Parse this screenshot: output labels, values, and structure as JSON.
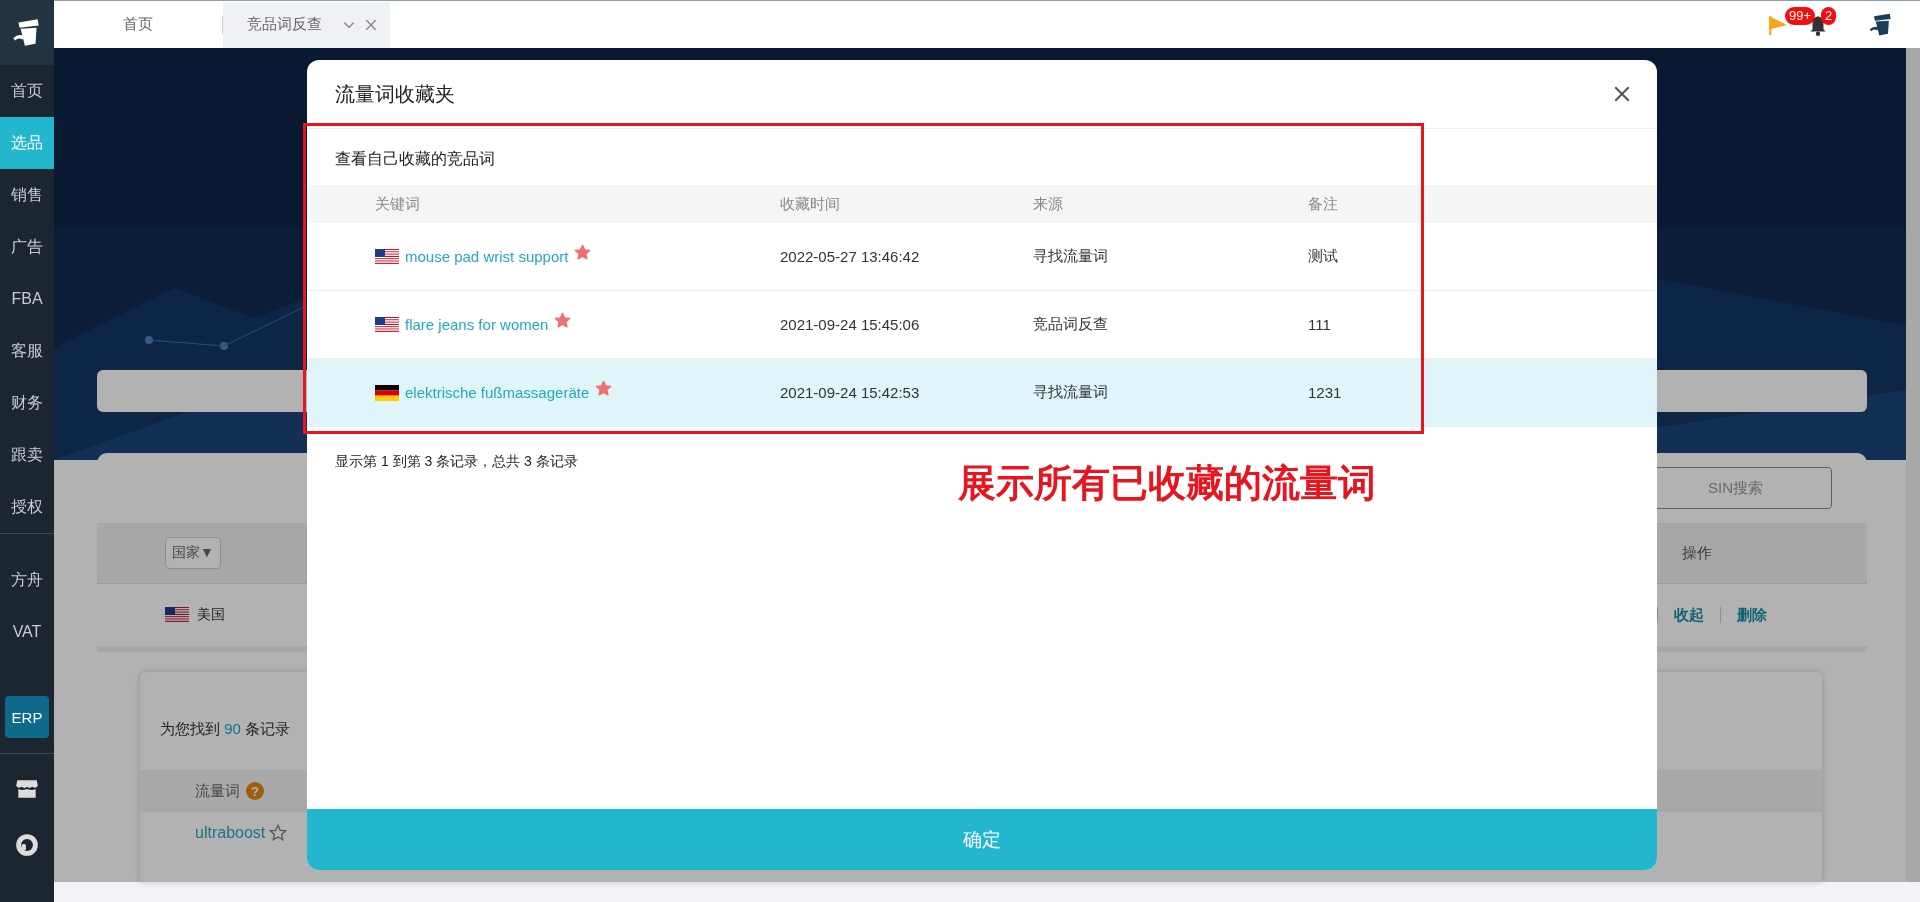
{
  "sidebar": {
    "items": [
      {
        "label": "首页",
        "selected": false
      },
      {
        "label": "选品",
        "selected": true
      },
      {
        "label": "销售",
        "selected": false
      },
      {
        "label": "广告",
        "selected": false
      },
      {
        "label": "FBA",
        "selected": false
      },
      {
        "label": "客服",
        "selected": false
      },
      {
        "label": "财务",
        "selected": false
      },
      {
        "label": "跟卖",
        "selected": false
      },
      {
        "label": "授权",
        "selected": false
      }
    ],
    "tools": [
      {
        "label": "方舟",
        "selected": false
      },
      {
        "label": "VAT",
        "selected": false
      }
    ],
    "erp_button": "ERP"
  },
  "tabs": [
    {
      "label": "首页",
      "selected": false,
      "closable": false
    },
    {
      "label": "竞品词反查",
      "selected": true,
      "closable": true
    }
  ],
  "header": {
    "flag_badge": "99+",
    "bell_badge": "2"
  },
  "background": {
    "search_placeholder": "SIN搜索",
    "country_dropdown": "国家▼",
    "actions_header": "操作",
    "row": {
      "kind": "us",
      "label": "美国",
      "actions": [
        "收起",
        "删除"
      ]
    },
    "result_prefix": "为您找到",
    "result_count": "90",
    "result_suffix": "条记录",
    "keyword_header": "流量词",
    "help_icon": "?",
    "keyword": "ultraboost"
  },
  "modal": {
    "title": "流量词收藏夹",
    "subtitle": "查看自己收藏的竞品词",
    "columns": [
      "关键词",
      "收藏时间",
      "来源",
      "备注"
    ],
    "rows": [
      {
        "kind": "us",
        "keyword": "mouse pad wrist support",
        "favorite": true,
        "time": "2022-05-27 13:46:42",
        "source": "寻找流量词",
        "note": "测试",
        "selected": false
      },
      {
        "kind": "us",
        "keyword": "flare jeans for women",
        "favorite": true,
        "time": "2021-09-24 15:45:06",
        "source": "竞品词反查",
        "note": "111",
        "selected": false
      },
      {
        "kind": "de",
        "keyword": "elektrische fußmassageräte",
        "favorite": true,
        "time": "2021-09-24 15:42:53",
        "source": "寻找流量词",
        "note": "1231",
        "selected": true
      }
    ],
    "summary": "显示第 1 到第 3 条记录，总共 3 条记录",
    "confirm_button": "确定"
  },
  "annotation": "展示所有已收藏的流量词"
}
